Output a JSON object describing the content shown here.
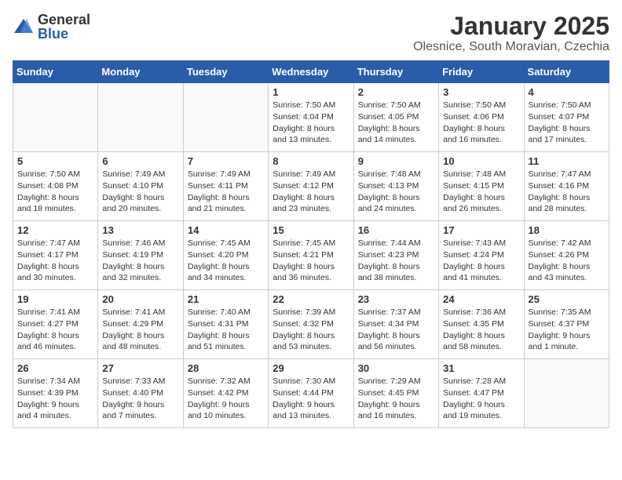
{
  "logo": {
    "general": "General",
    "blue": "Blue"
  },
  "header": {
    "month": "January 2025",
    "location": "Olesnice, South Moravian, Czechia"
  },
  "weekdays": [
    "Sunday",
    "Monday",
    "Tuesday",
    "Wednesday",
    "Thursday",
    "Friday",
    "Saturday"
  ],
  "weeks": [
    [
      {
        "day": "",
        "info": ""
      },
      {
        "day": "",
        "info": ""
      },
      {
        "day": "",
        "info": ""
      },
      {
        "day": "1",
        "info": "Sunrise: 7:50 AM\nSunset: 4:04 PM\nDaylight: 8 hours\nand 13 minutes."
      },
      {
        "day": "2",
        "info": "Sunrise: 7:50 AM\nSunset: 4:05 PM\nDaylight: 8 hours\nand 14 minutes."
      },
      {
        "day": "3",
        "info": "Sunrise: 7:50 AM\nSunset: 4:06 PM\nDaylight: 8 hours\nand 16 minutes."
      },
      {
        "day": "4",
        "info": "Sunrise: 7:50 AM\nSunset: 4:07 PM\nDaylight: 8 hours\nand 17 minutes."
      }
    ],
    [
      {
        "day": "5",
        "info": "Sunrise: 7:50 AM\nSunset: 4:08 PM\nDaylight: 8 hours\nand 18 minutes."
      },
      {
        "day": "6",
        "info": "Sunrise: 7:49 AM\nSunset: 4:10 PM\nDaylight: 8 hours\nand 20 minutes."
      },
      {
        "day": "7",
        "info": "Sunrise: 7:49 AM\nSunset: 4:11 PM\nDaylight: 8 hours\nand 21 minutes."
      },
      {
        "day": "8",
        "info": "Sunrise: 7:49 AM\nSunset: 4:12 PM\nDaylight: 8 hours\nand 23 minutes."
      },
      {
        "day": "9",
        "info": "Sunrise: 7:48 AM\nSunset: 4:13 PM\nDaylight: 8 hours\nand 24 minutes."
      },
      {
        "day": "10",
        "info": "Sunrise: 7:48 AM\nSunset: 4:15 PM\nDaylight: 8 hours\nand 26 minutes."
      },
      {
        "day": "11",
        "info": "Sunrise: 7:47 AM\nSunset: 4:16 PM\nDaylight: 8 hours\nand 28 minutes."
      }
    ],
    [
      {
        "day": "12",
        "info": "Sunrise: 7:47 AM\nSunset: 4:17 PM\nDaylight: 8 hours\nand 30 minutes."
      },
      {
        "day": "13",
        "info": "Sunrise: 7:46 AM\nSunset: 4:19 PM\nDaylight: 8 hours\nand 32 minutes."
      },
      {
        "day": "14",
        "info": "Sunrise: 7:45 AM\nSunset: 4:20 PM\nDaylight: 8 hours\nand 34 minutes."
      },
      {
        "day": "15",
        "info": "Sunrise: 7:45 AM\nSunset: 4:21 PM\nDaylight: 8 hours\nand 36 minutes."
      },
      {
        "day": "16",
        "info": "Sunrise: 7:44 AM\nSunset: 4:23 PM\nDaylight: 8 hours\nand 38 minutes."
      },
      {
        "day": "17",
        "info": "Sunrise: 7:43 AM\nSunset: 4:24 PM\nDaylight: 8 hours\nand 41 minutes."
      },
      {
        "day": "18",
        "info": "Sunrise: 7:42 AM\nSunset: 4:26 PM\nDaylight: 8 hours\nand 43 minutes."
      }
    ],
    [
      {
        "day": "19",
        "info": "Sunrise: 7:41 AM\nSunset: 4:27 PM\nDaylight: 8 hours\nand 46 minutes."
      },
      {
        "day": "20",
        "info": "Sunrise: 7:41 AM\nSunset: 4:29 PM\nDaylight: 8 hours\nand 48 minutes."
      },
      {
        "day": "21",
        "info": "Sunrise: 7:40 AM\nSunset: 4:31 PM\nDaylight: 8 hours\nand 51 minutes."
      },
      {
        "day": "22",
        "info": "Sunrise: 7:39 AM\nSunset: 4:32 PM\nDaylight: 8 hours\nand 53 minutes."
      },
      {
        "day": "23",
        "info": "Sunrise: 7:37 AM\nSunset: 4:34 PM\nDaylight: 8 hours\nand 56 minutes."
      },
      {
        "day": "24",
        "info": "Sunrise: 7:36 AM\nSunset: 4:35 PM\nDaylight: 8 hours\nand 58 minutes."
      },
      {
        "day": "25",
        "info": "Sunrise: 7:35 AM\nSunset: 4:37 PM\nDaylight: 9 hours\nand 1 minute."
      }
    ],
    [
      {
        "day": "26",
        "info": "Sunrise: 7:34 AM\nSunset: 4:39 PM\nDaylight: 9 hours\nand 4 minutes."
      },
      {
        "day": "27",
        "info": "Sunrise: 7:33 AM\nSunset: 4:40 PM\nDaylight: 9 hours\nand 7 minutes."
      },
      {
        "day": "28",
        "info": "Sunrise: 7:32 AM\nSunset: 4:42 PM\nDaylight: 9 hours\nand 10 minutes."
      },
      {
        "day": "29",
        "info": "Sunrise: 7:30 AM\nSunset: 4:44 PM\nDaylight: 9 hours\nand 13 minutes."
      },
      {
        "day": "30",
        "info": "Sunrise: 7:29 AM\nSunset: 4:45 PM\nDaylight: 9 hours\nand 16 minutes."
      },
      {
        "day": "31",
        "info": "Sunrise: 7:28 AM\nSunset: 4:47 PM\nDaylight: 9 hours\nand 19 minutes."
      },
      {
        "day": "",
        "info": ""
      }
    ]
  ]
}
